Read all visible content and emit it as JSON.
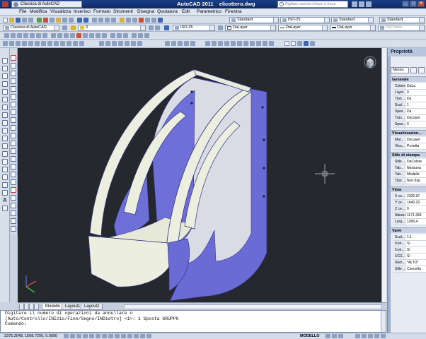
{
  "title_bar": {
    "workspace": "Classica di AutoCAD",
    "app_name": "AutoCAD 2011",
    "file_name": "elicottero.dwg",
    "search_placeholder": "Digitare parola chiave o frase"
  },
  "menu": [
    "File",
    "Modifica",
    "Visualizza",
    "Inserisci",
    "Formato",
    "Strumenti",
    "Disegna",
    "Quotatura",
    "Edit",
    "Parametrico",
    "Finestra"
  ],
  "toolbars": {
    "workspace_combo": "Classica di AutoCAD",
    "text_style": "Standard",
    "dim_style": "ISO-25",
    "table_style": "Standard",
    "mleader_style": "Standard",
    "dim_style_2": "ISO-25",
    "layer": "0",
    "color": "DaLayer",
    "linetype": "DaLayer",
    "lineweight": "DaLayer",
    "plot_style": "DaColore"
  },
  "tabs": [
    "Modello",
    "Layout1",
    "Layout2"
  ],
  "active_tab": 0,
  "command_line": {
    "lines": [
      "Digitare il numero di operazioni da annullare o",
      "[Auto/Controllo/INIzio/Fine/Segno/INDietro] <1>: 1 Sposta GRUPPO",
      "Comando:"
    ]
  },
  "status_bar": {
    "coordinates": "2375.3048, 1568.7200, 0.0000",
    "model": "MODELLO"
  },
  "properties": {
    "title": "Proprietà",
    "selection": "Nessu",
    "sections": [
      {
        "title": "Generale",
        "rows": [
          {
            "k": "Colore",
            "v": "DaLa"
          },
          {
            "k": "Layer",
            "v": "0"
          },
          {
            "k": "Tipo ...",
            "v": "Da"
          },
          {
            "k": "Scal...",
            "v": "1"
          },
          {
            "k": "Spes...",
            "v": "Da"
          },
          {
            "k": "Tras...",
            "v": "DaLayer"
          },
          {
            "k": "Spes...",
            "v": "0"
          }
        ]
      },
      {
        "title": "Visualizzazion...",
        "rows": [
          {
            "k": "Mat...",
            "v": "DaLayer"
          },
          {
            "k": "Visu...",
            "v": "Proietta"
          }
        ]
      },
      {
        "title": "Stile di stampa",
        "rows": [
          {
            "k": "Stile ...",
            "v": "DaColore"
          },
          {
            "k": "Tab...",
            "v": "Nessuna"
          },
          {
            "k": "Tab...",
            "v": "Modello"
          },
          {
            "k": "Tipo ...",
            "v": "Non dsp"
          }
        ]
      },
      {
        "title": "Vista",
        "rows": [
          {
            "k": "X ce...",
            "v": "2325.97"
          },
          {
            "k": "Y ce...",
            "v": "1640.23"
          },
          {
            "k": "Z ce...",
            "v": "0"
          },
          {
            "k": "Altezza",
            "v": "1171.399"
          },
          {
            "k": "Larg...",
            "v": "1266.4"
          }
        ]
      },
      {
        "title": "Varie",
        "rows": [
          {
            "k": "Scal...",
            "v": "1:1"
          },
          {
            "k": "Icon...",
            "v": "Sì"
          },
          {
            "k": "Icon...",
            "v": "Sì"
          },
          {
            "k": "UCS ...",
            "v": "Sì"
          },
          {
            "k": "Nom...",
            "v": "*ALTO*"
          },
          {
            "k": "Stile ...",
            "v": "Concettu"
          }
        ]
      }
    ]
  },
  "colors": {
    "viewport_bg": "#25292e",
    "model_face": "#6f6fd8",
    "model_light": "#eceee0",
    "ribbon_blue": "#1b3f86"
  }
}
